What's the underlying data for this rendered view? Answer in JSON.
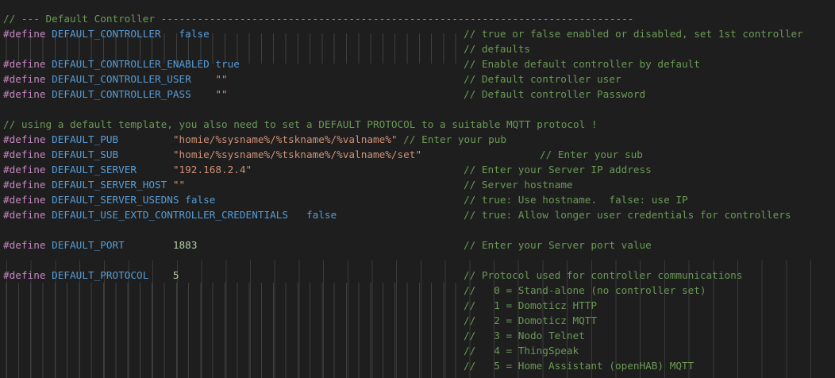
{
  "editor": {
    "lines": [
      {
        "segs": [
          {
            "c": "cm",
            "t": "// --- Default Controller ------------------------------------------------------------------------------"
          }
        ]
      },
      {
        "segs": [
          {
            "c": "pp",
            "t": "#define"
          },
          {
            "c": "mac",
            "t": " DEFAULT_CONTROLLER"
          },
          {
            "c": "kw",
            "t": "   false",
            "x": 0
          },
          {
            "c": "cm",
            "t": "// true or false enabled or disabled, set 1st controller",
            "col": 1
          }
        ]
      },
      {
        "segs": [
          {
            "c": "cm",
            "t": "// defaults",
            "col": 1
          }
        ]
      },
      {
        "segs": [
          {
            "c": "pp",
            "t": "#define"
          },
          {
            "c": "mac",
            "t": " DEFAULT_CONTROLLER_ENABLED"
          },
          {
            "c": "kw",
            "t": " true"
          },
          {
            "c": "cm",
            "t": "// Enable default controller by default",
            "col": 1
          }
        ]
      },
      {
        "segs": [
          {
            "c": "pp",
            "t": "#define"
          },
          {
            "c": "mac",
            "t": " DEFAULT_CONTROLLER_USER"
          },
          {
            "c": "str",
            "t": "    \"\""
          },
          {
            "c": "cm",
            "t": "// Default controller user",
            "col": 1
          }
        ]
      },
      {
        "segs": [
          {
            "c": "pp",
            "t": "#define"
          },
          {
            "c": "mac",
            "t": " DEFAULT_CONTROLLER_PASS"
          },
          {
            "c": "str",
            "t": "    \"\""
          },
          {
            "c": "cm",
            "t": "// Default controller Password",
            "col": 1
          }
        ]
      },
      {
        "segs": []
      },
      {
        "segs": [
          {
            "c": "cm",
            "t": "// using a default template, you also need to set a DEFAULT PROTOCOL to a suitable MQTT protocol !"
          }
        ]
      },
      {
        "segs": [
          {
            "c": "pp",
            "t": "#define"
          },
          {
            "c": "mac",
            "t": " DEFAULT_PUB"
          },
          {
            "c": "str",
            "t": "         \"homie/%sysname%/%tskname%/%valname%\""
          },
          {
            "c": "cm",
            "t": " // Enter your pub"
          }
        ]
      },
      {
        "segs": [
          {
            "c": "pp",
            "t": "#define"
          },
          {
            "c": "mac",
            "t": " DEFAULT_SUB"
          },
          {
            "c": "str",
            "t": "         \"homie/%sysname%/%tskname%/%valname%/set\""
          },
          {
            "c": "cm",
            "t": "// Enter your sub",
            "col": 2
          }
        ]
      },
      {
        "segs": [
          {
            "c": "pp",
            "t": "#define"
          },
          {
            "c": "mac",
            "t": " DEFAULT_SERVER"
          },
          {
            "c": "str",
            "t": "      \"192.168.2.4\""
          },
          {
            "c": "cm",
            "t": "// Enter your Server IP address",
            "col": 1
          }
        ]
      },
      {
        "segs": [
          {
            "c": "pp",
            "t": "#define"
          },
          {
            "c": "mac",
            "t": " DEFAULT_SERVER_HOST"
          },
          {
            "c": "str",
            "t": " \"\""
          },
          {
            "c": "cm",
            "t": "// Server hostname",
            "col": 1
          }
        ]
      },
      {
        "segs": [
          {
            "c": "pp",
            "t": "#define"
          },
          {
            "c": "mac",
            "t": " DEFAULT_SERVER_USEDNS"
          },
          {
            "c": "kw",
            "t": " false"
          },
          {
            "c": "cm",
            "t": "// true: Use hostname.  false: use IP",
            "col": 1
          }
        ]
      },
      {
        "segs": [
          {
            "c": "pp",
            "t": "#define"
          },
          {
            "c": "mac",
            "t": " DEFAULT_USE_EXTD_CONTROLLER_CREDENTIALS"
          },
          {
            "c": "kw",
            "t": "   false"
          },
          {
            "c": "cm",
            "t": "// true: Allow longer user credentials for controllers",
            "col": 1
          }
        ]
      },
      {
        "segs": []
      },
      {
        "segs": [
          {
            "c": "pp",
            "t": "#define"
          },
          {
            "c": "mac",
            "t": " DEFAULT_PORT"
          },
          {
            "c": "num",
            "t": "        1883"
          },
          {
            "c": "cm",
            "t": "// Enter your Server port value",
            "col": 1
          }
        ]
      },
      {
        "segs": []
      },
      {
        "segs": [
          {
            "c": "pp",
            "t": "#define"
          },
          {
            "c": "mac",
            "t": " DEFAULT_PROTOCOL"
          },
          {
            "c": "num",
            "t": "    5"
          },
          {
            "c": "cm",
            "t": "// Protocol used for controller communications",
            "col": 1
          }
        ]
      },
      {
        "segs": [
          {
            "c": "cm",
            "t": "//   0 = Stand-alone (no controller set)",
            "col": 1
          }
        ]
      },
      {
        "segs": [
          {
            "c": "cm",
            "t": "//   1 = Domoticz HTTP",
            "col": 1
          }
        ]
      },
      {
        "segs": [
          {
            "c": "cm",
            "t": "//   2 = Domoticz MQTT",
            "col": 1
          }
        ]
      },
      {
        "segs": [
          {
            "c": "cm",
            "t": "//   3 = Nodo Telnet",
            "col": 1
          }
        ]
      },
      {
        "segs": [
          {
            "c": "cm",
            "t": "//   4 = ThingSpeak",
            "col": 1
          }
        ]
      },
      {
        "segs": [
          {
            "c": "cm",
            "t": "//   5 = Home Assistant (openHAB) MQTT",
            "col": 1
          }
        ]
      }
    ]
  }
}
